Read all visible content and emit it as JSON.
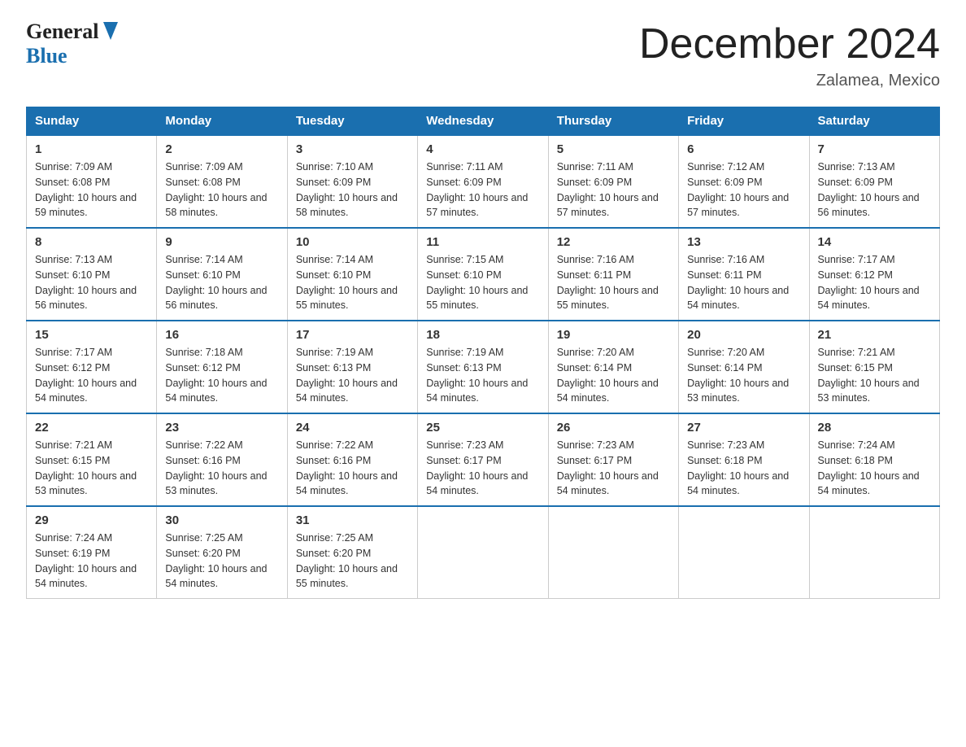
{
  "header": {
    "title": "December 2024",
    "subtitle": "Zalamea, Mexico",
    "logo_line1": "General",
    "logo_line2": "Blue"
  },
  "calendar": {
    "days_of_week": [
      "Sunday",
      "Monday",
      "Tuesday",
      "Wednesday",
      "Thursday",
      "Friday",
      "Saturday"
    ],
    "weeks": [
      [
        {
          "day": "1",
          "sunrise": "7:09 AM",
          "sunset": "6:08 PM",
          "daylight": "10 hours and 59 minutes."
        },
        {
          "day": "2",
          "sunrise": "7:09 AM",
          "sunset": "6:08 PM",
          "daylight": "10 hours and 58 minutes."
        },
        {
          "day": "3",
          "sunrise": "7:10 AM",
          "sunset": "6:09 PM",
          "daylight": "10 hours and 58 minutes."
        },
        {
          "day": "4",
          "sunrise": "7:11 AM",
          "sunset": "6:09 PM",
          "daylight": "10 hours and 57 minutes."
        },
        {
          "day": "5",
          "sunrise": "7:11 AM",
          "sunset": "6:09 PM",
          "daylight": "10 hours and 57 minutes."
        },
        {
          "day": "6",
          "sunrise": "7:12 AM",
          "sunset": "6:09 PM",
          "daylight": "10 hours and 57 minutes."
        },
        {
          "day": "7",
          "sunrise": "7:13 AM",
          "sunset": "6:09 PM",
          "daylight": "10 hours and 56 minutes."
        }
      ],
      [
        {
          "day": "8",
          "sunrise": "7:13 AM",
          "sunset": "6:10 PM",
          "daylight": "10 hours and 56 minutes."
        },
        {
          "day": "9",
          "sunrise": "7:14 AM",
          "sunset": "6:10 PM",
          "daylight": "10 hours and 56 minutes."
        },
        {
          "day": "10",
          "sunrise": "7:14 AM",
          "sunset": "6:10 PM",
          "daylight": "10 hours and 55 minutes."
        },
        {
          "day": "11",
          "sunrise": "7:15 AM",
          "sunset": "6:10 PM",
          "daylight": "10 hours and 55 minutes."
        },
        {
          "day": "12",
          "sunrise": "7:16 AM",
          "sunset": "6:11 PM",
          "daylight": "10 hours and 55 minutes."
        },
        {
          "day": "13",
          "sunrise": "7:16 AM",
          "sunset": "6:11 PM",
          "daylight": "10 hours and 54 minutes."
        },
        {
          "day": "14",
          "sunrise": "7:17 AM",
          "sunset": "6:12 PM",
          "daylight": "10 hours and 54 minutes."
        }
      ],
      [
        {
          "day": "15",
          "sunrise": "7:17 AM",
          "sunset": "6:12 PM",
          "daylight": "10 hours and 54 minutes."
        },
        {
          "day": "16",
          "sunrise": "7:18 AM",
          "sunset": "6:12 PM",
          "daylight": "10 hours and 54 minutes."
        },
        {
          "day": "17",
          "sunrise": "7:19 AM",
          "sunset": "6:13 PM",
          "daylight": "10 hours and 54 minutes."
        },
        {
          "day": "18",
          "sunrise": "7:19 AM",
          "sunset": "6:13 PM",
          "daylight": "10 hours and 54 minutes."
        },
        {
          "day": "19",
          "sunrise": "7:20 AM",
          "sunset": "6:14 PM",
          "daylight": "10 hours and 54 minutes."
        },
        {
          "day": "20",
          "sunrise": "7:20 AM",
          "sunset": "6:14 PM",
          "daylight": "10 hours and 53 minutes."
        },
        {
          "day": "21",
          "sunrise": "7:21 AM",
          "sunset": "6:15 PM",
          "daylight": "10 hours and 53 minutes."
        }
      ],
      [
        {
          "day": "22",
          "sunrise": "7:21 AM",
          "sunset": "6:15 PM",
          "daylight": "10 hours and 53 minutes."
        },
        {
          "day": "23",
          "sunrise": "7:22 AM",
          "sunset": "6:16 PM",
          "daylight": "10 hours and 53 minutes."
        },
        {
          "day": "24",
          "sunrise": "7:22 AM",
          "sunset": "6:16 PM",
          "daylight": "10 hours and 54 minutes."
        },
        {
          "day": "25",
          "sunrise": "7:23 AM",
          "sunset": "6:17 PM",
          "daylight": "10 hours and 54 minutes."
        },
        {
          "day": "26",
          "sunrise": "7:23 AM",
          "sunset": "6:17 PM",
          "daylight": "10 hours and 54 minutes."
        },
        {
          "day": "27",
          "sunrise": "7:23 AM",
          "sunset": "6:18 PM",
          "daylight": "10 hours and 54 minutes."
        },
        {
          "day": "28",
          "sunrise": "7:24 AM",
          "sunset": "6:18 PM",
          "daylight": "10 hours and 54 minutes."
        }
      ],
      [
        {
          "day": "29",
          "sunrise": "7:24 AM",
          "sunset": "6:19 PM",
          "daylight": "10 hours and 54 minutes."
        },
        {
          "day": "30",
          "sunrise": "7:25 AM",
          "sunset": "6:20 PM",
          "daylight": "10 hours and 54 minutes."
        },
        {
          "day": "31",
          "sunrise": "7:25 AM",
          "sunset": "6:20 PM",
          "daylight": "10 hours and 55 minutes."
        },
        null,
        null,
        null,
        null
      ]
    ]
  },
  "labels": {
    "sunrise_prefix": "Sunrise: ",
    "sunset_prefix": "Sunset: ",
    "daylight_prefix": "Daylight: "
  }
}
